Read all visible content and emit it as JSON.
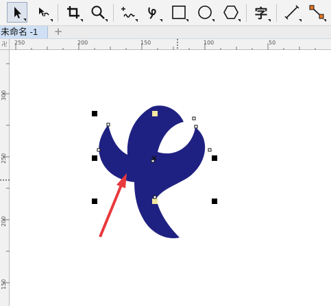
{
  "toolbar": {
    "tools": [
      {
        "name": "pick-tool",
        "icon": "arrow-pointer-icon",
        "active": true
      },
      {
        "name": "shape-tool",
        "icon": "node-edit-icon"
      },
      {
        "name": "crop-tool",
        "icon": "crop-icon"
      },
      {
        "name": "zoom-tool",
        "icon": "magnifier-icon"
      },
      {
        "name": "freehand-tool",
        "icon": "freehand-icon"
      },
      {
        "name": "artistic-media-tool",
        "icon": "brush-stroke-icon"
      },
      {
        "name": "rectangle-tool",
        "icon": "rectangle-icon"
      },
      {
        "name": "ellipse-tool",
        "icon": "ellipse-icon"
      },
      {
        "name": "polygon-tool",
        "icon": "hexagon-icon"
      },
      {
        "name": "text-tool",
        "icon": "text-icon",
        "label": "字"
      },
      {
        "name": "parallel-dimension-tool",
        "icon": "dimension-line-icon"
      },
      {
        "name": "connector-tool",
        "icon": "connector-icon"
      }
    ]
  },
  "document": {
    "tab_title": "未命名 -1",
    "add_tab_label": "+"
  },
  "ruler": {
    "corner_label": "卍",
    "top_labels": [
      "250",
      "200",
      "150",
      "100",
      "50"
    ],
    "left_labels": [
      "300",
      "250",
      "200",
      "150"
    ]
  },
  "colors": {
    "shape_fill": "#1f2182",
    "arrow": "#e8393d",
    "toolbar_bg": "#f3f3f3",
    "tab_active": "#cfe0f5",
    "node_highlight": "#f2e8a0"
  },
  "canvas": {
    "object_icon": "china-telecom-logo-shape",
    "annotation_icon": "red-arrow-icon"
  }
}
